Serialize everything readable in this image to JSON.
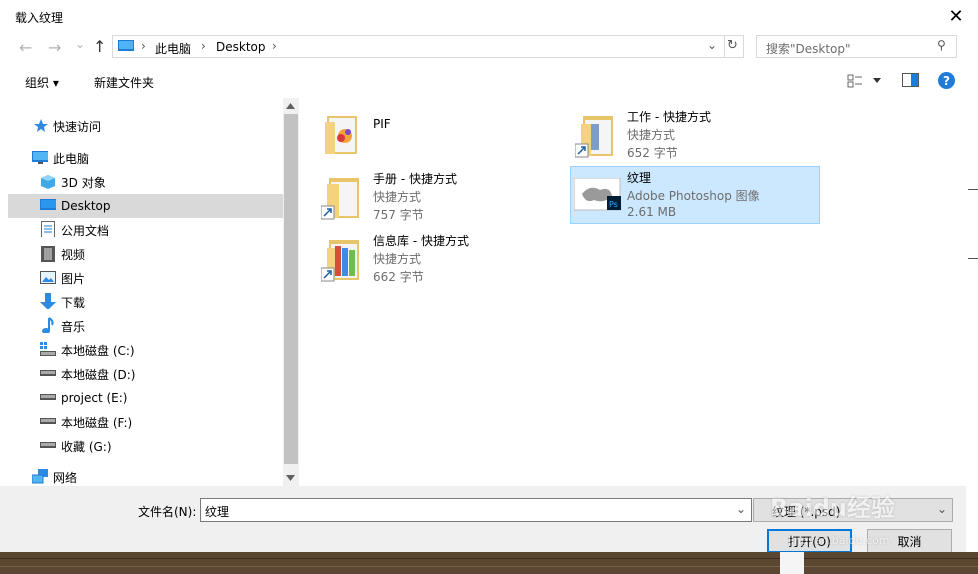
{
  "window": {
    "title": "载入纹理",
    "close_glyph": "✕"
  },
  "nav": {
    "back_glyph": "←",
    "forward_glyph": "→",
    "recent_glyph": "⌄",
    "up_glyph": "↑",
    "breadcrumb": [
      "此电脑",
      "Desktop"
    ],
    "sep_glyph": "›",
    "dropdown_glyph": "⌄",
    "refresh_glyph": "↻",
    "search_placeholder": "搜索\"Desktop\"",
    "search_glyph": "⚲"
  },
  "toolbar": {
    "organize": "组织 ▾",
    "new_folder": "新建文件夹",
    "help_glyph": "?"
  },
  "sidebar": {
    "items": [
      {
        "label": "快速访问",
        "icon": "star-icon"
      },
      {
        "label": "此电脑",
        "icon": "computer-icon"
      },
      {
        "label": "3D 对象",
        "icon": "cube-icon"
      },
      {
        "label": "Desktop",
        "icon": "desktop-icon"
      },
      {
        "label": "公用文档",
        "icon": "document-icon"
      },
      {
        "label": "视频",
        "icon": "video-icon"
      },
      {
        "label": "图片",
        "icon": "picture-icon"
      },
      {
        "label": "下载",
        "icon": "download-icon"
      },
      {
        "label": "音乐",
        "icon": "music-icon"
      },
      {
        "label": "本地磁盘 (C:)",
        "icon": "drive-icon"
      },
      {
        "label": "本地磁盘 (D:)",
        "icon": "drive-icon"
      },
      {
        "label": "project (E:)",
        "icon": "drive-icon"
      },
      {
        "label": "本地磁盘 (F:)",
        "icon": "drive-icon"
      },
      {
        "label": "收藏 (G:)",
        "icon": "drive-icon"
      },
      {
        "label": "网络",
        "icon": "network-icon"
      }
    ],
    "selected": "Desktop"
  },
  "files": [
    {
      "name": "PIF",
      "type": "",
      "size": "",
      "icon": "folder-icon"
    },
    {
      "name": "工作 - 快捷方式",
      "type": "快捷方式",
      "size": "652 字节",
      "icon": "folder-shortcut-icon"
    },
    {
      "name": "手册 - 快捷方式",
      "type": "快捷方式",
      "size": "757 字节",
      "icon": "folder-shortcut-icon"
    },
    {
      "name": "纹理",
      "type": "Adobe Photoshop 图像",
      "size": "2.61 MB",
      "icon": "psd-thumbnail-icon"
    },
    {
      "name": "信息库 - 快捷方式",
      "type": "快捷方式",
      "size": "662 字节",
      "icon": "folder-shortcut-icon"
    }
  ],
  "bottom": {
    "filename_label": "文件名(N):",
    "filename_value": "纹理",
    "filetype_value": "纹理 (*.psd)",
    "open_label": "打开(O)",
    "cancel_label": "取消"
  },
  "watermark": {
    "brand": "Baidu经验",
    "url": "jingyan.baidu.com"
  }
}
